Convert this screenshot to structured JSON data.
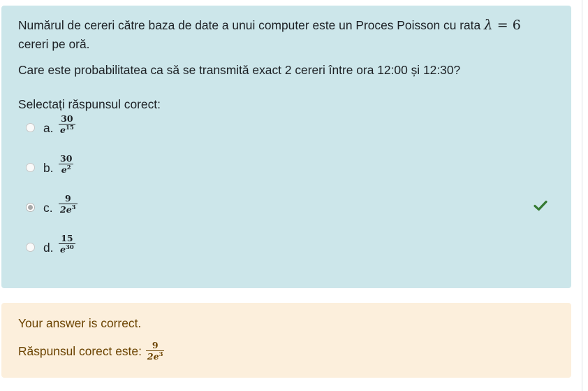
{
  "question": {
    "text_before": "Numărul de cereri către baza de date a unui computer este un Proces Poisson cu rata ",
    "lambda_symbol": "λ",
    "equals": " = ",
    "rate_value": "6",
    "text_after": "cereri pe oră.",
    "question_line": "Care este probabilitatea ca să se transmită exact 2 cereri între ora 12:00 și 12:30?"
  },
  "prompt": "Selectați răspunsul corect:",
  "answers": [
    {
      "letter": "a.",
      "numerator": "30",
      "denominator_base": "e",
      "denominator_exp": "15",
      "selected": false
    },
    {
      "letter": "b.",
      "numerator": "30",
      "denominator_base": "e",
      "denominator_exp": "2",
      "selected": false
    },
    {
      "letter": "c.",
      "numerator": "9",
      "denominator_base": "2e",
      "denominator_exp": "3",
      "selected": true
    },
    {
      "letter": "d.",
      "numerator": "15",
      "denominator_base": "e",
      "denominator_exp": "30",
      "selected": false
    }
  ],
  "correct_icon": "check-icon",
  "feedback": {
    "status": "Your answer is correct.",
    "correct_label": "Răspunsul corect este:",
    "numerator": "9",
    "denominator_base": "2e",
    "denominator_exp": "3"
  },
  "colors": {
    "question_bg": "#cce6ea",
    "feedback_bg": "#fcefdc",
    "feedback_text": "#6b4300",
    "check_green": "#357a32"
  }
}
